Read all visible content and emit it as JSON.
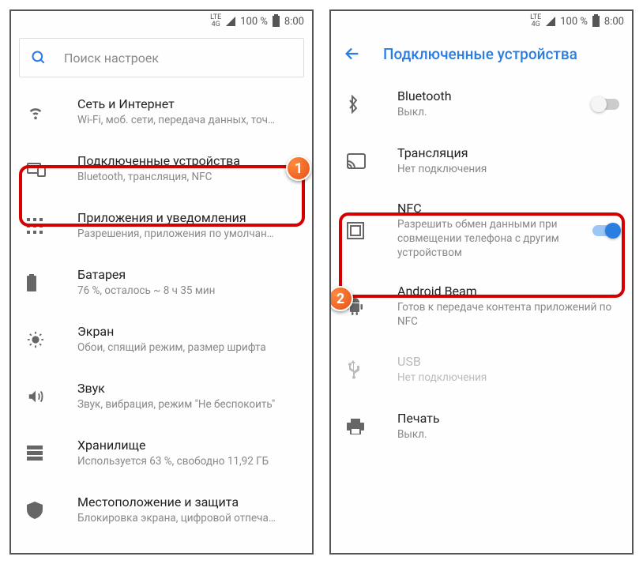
{
  "status": {
    "lte_top": "LTE",
    "lte_bot": "4G",
    "battery_pct": "100 %",
    "time": "8:00"
  },
  "left": {
    "search_placeholder": "Поиск настроек",
    "items": [
      {
        "title": "Сеть и Интернет",
        "sub": "Wi-Fi, моб. сети, передача данных, точ…"
      },
      {
        "title": "Подключенные устройства",
        "sub": "Bluetooth, трансляция, NFC"
      },
      {
        "title": "Приложения и уведомления",
        "sub": "Разрешения, приложения по умолчан…"
      },
      {
        "title": "Батарея",
        "sub": "76 %, осталось ~ 8 ч 35 мин"
      },
      {
        "title": "Экран",
        "sub": "Обои, спящий режим, размер шрифта"
      },
      {
        "title": "Звук",
        "sub": "Звук, вибрация, режим \"Не беспокоить\""
      },
      {
        "title": "Хранилище",
        "sub": "Используется 63 %, свободно 11,92 ГБ"
      },
      {
        "title": "Местоположение и защита",
        "sub": "Блокировка экрана, цифровой отпеча…"
      }
    ]
  },
  "right": {
    "header": "Подключенные устройства",
    "items": [
      {
        "title": "Bluetooth",
        "sub": "Выкл."
      },
      {
        "title": "Трансляция",
        "sub": "Нет подключения"
      },
      {
        "title": "NFC",
        "sub": "Разрешить обмен данными при совмещении телефона с другим устройством"
      },
      {
        "title": "Android Beam",
        "sub": "Готов к передаче контента приложений по NFC"
      },
      {
        "title": "USB",
        "sub": "Нет подключения"
      },
      {
        "title": "Печать",
        "sub": "Выкл."
      }
    ]
  },
  "badges": {
    "one": "1",
    "two": "2"
  }
}
